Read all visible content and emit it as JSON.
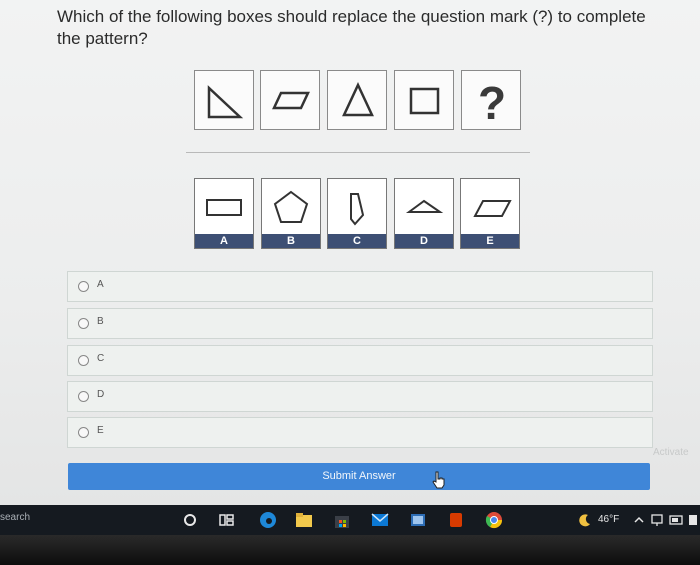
{
  "question": {
    "text": "Which of the following boxes should replace the question mark (?) to complete the pattern?"
  },
  "pattern": {
    "items": [
      "right-triangle",
      "parallelogram",
      "triangle",
      "square",
      "question-mark"
    ],
    "unknown_symbol": "?"
  },
  "options_figure": [
    {
      "label": "A",
      "shape": "rectangle"
    },
    {
      "label": "B",
      "shape": "pentagon"
    },
    {
      "label": "C",
      "shape": "slanted-quadrilateral"
    },
    {
      "label": "D",
      "shape": "flat-diamond"
    },
    {
      "label": "E",
      "shape": "parallelogram"
    }
  ],
  "choices": [
    {
      "label": "A"
    },
    {
      "label": "B"
    },
    {
      "label": "C"
    },
    {
      "label": "D"
    },
    {
      "label": "E"
    }
  ],
  "submit": {
    "label": "Submit Answer"
  },
  "watermark": {
    "text": "Activate"
  },
  "taskbar": {
    "search_text": "search",
    "temperature": "46°F"
  },
  "colors": {
    "submit_button": "#3f86d8",
    "option_label_bar": "#3d4f74",
    "taskbar": "#151a20"
  }
}
